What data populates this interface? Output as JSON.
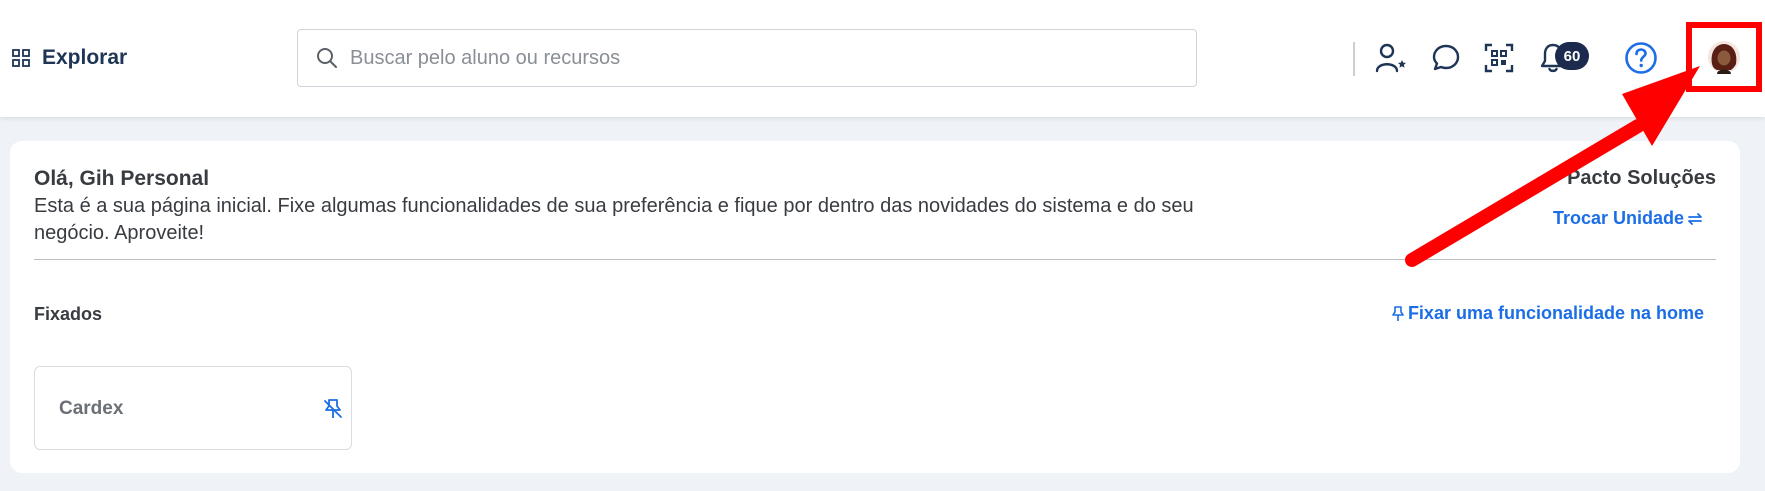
{
  "header": {
    "explore_label": "Explorar",
    "search_placeholder": "Buscar pelo aluno ou recursos",
    "notifications_count": "60",
    "icons": [
      "grid-icon",
      "search-icon",
      "add-user-icon",
      "chat-icon",
      "qr-code-icon",
      "bell-icon",
      "help-icon",
      "avatar"
    ]
  },
  "home": {
    "greeting": "Olá, Gih Personal",
    "intro": "Esta é a sua página inicial. Fixe algumas funcionalidades de sua preferência e fique por dentro das novidades do sistema e do seu negócio. Aproveite!",
    "unit_name": "Pacto Soluções",
    "switch_unit_label": "Trocar Unidade",
    "pinned_title": "Fixados",
    "pin_feature_label": "Fixar uma funcionalidade na home",
    "pinned_items": [
      {
        "label": "Cardex"
      }
    ]
  },
  "colors": {
    "accent": "#1b6ee6",
    "navy": "#1e3556",
    "annotation": "#ff0000"
  }
}
